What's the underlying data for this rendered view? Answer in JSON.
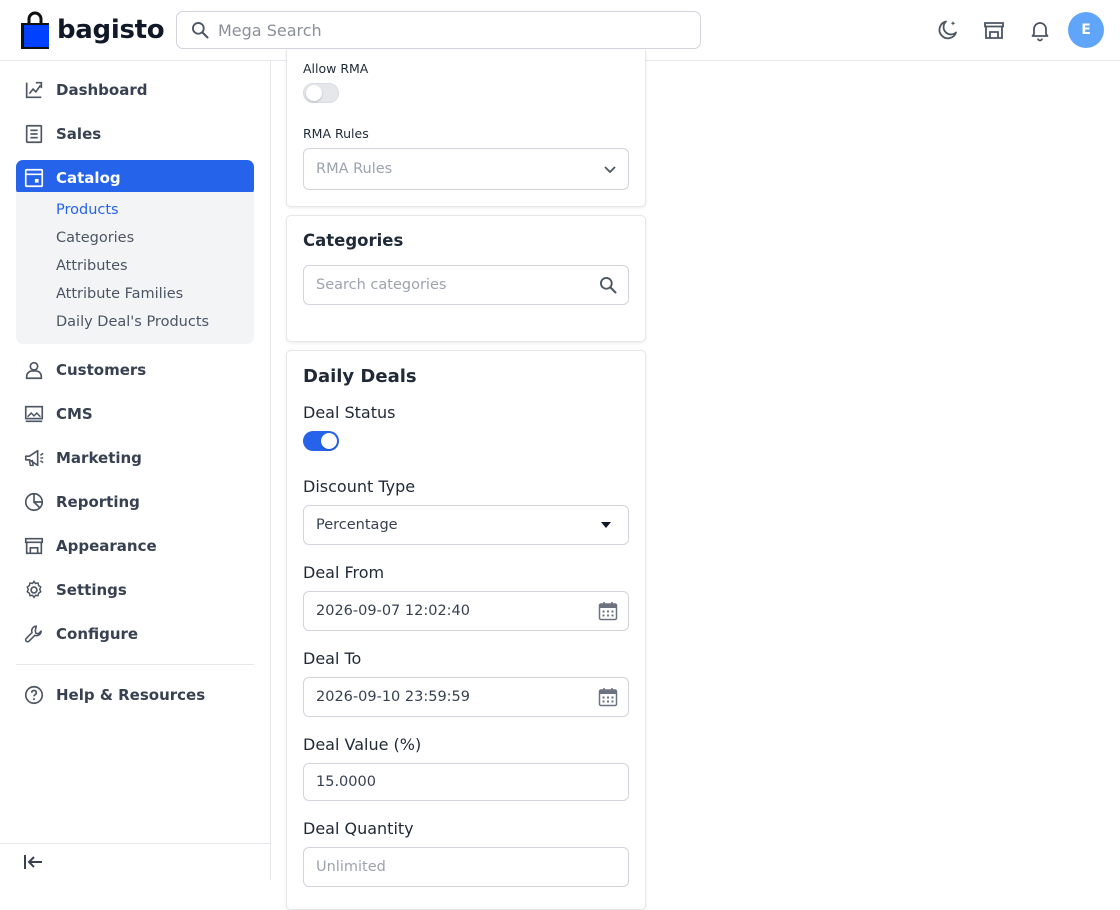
{
  "header": {
    "brand": "bagisto",
    "search_placeholder": "Mega Search",
    "avatar_initial": "E",
    "colors": {
      "accent": "#2563eb",
      "avatar": "#60a5fa",
      "logo_bag": "#0041ff"
    },
    "icons": [
      "moon-icon",
      "store-icon",
      "bell-icon"
    ]
  },
  "sidebar": {
    "items": [
      {
        "label": "Dashboard",
        "icon": "dashboard-icon"
      },
      {
        "label": "Sales",
        "icon": "sales-icon"
      },
      {
        "label": "Catalog",
        "icon": "catalog-icon"
      },
      {
        "label": "Customers",
        "icon": "customers-icon"
      },
      {
        "label": "CMS",
        "icon": "cms-icon"
      },
      {
        "label": "Marketing",
        "icon": "marketing-icon"
      },
      {
        "label": "Reporting",
        "icon": "reporting-icon"
      },
      {
        "label": "Appearance",
        "icon": "appearance-icon"
      },
      {
        "label": "Settings",
        "icon": "settings-icon"
      },
      {
        "label": "Configure",
        "icon": "configure-icon"
      },
      {
        "label": "Help & Resources",
        "icon": "help-icon"
      }
    ],
    "active_item": "Catalog",
    "catalog_sub": [
      "Products",
      "Categories",
      "Attributes",
      "Attribute Families",
      "Daily Deal's Products"
    ],
    "active_sub": "Products"
  },
  "rma_card": {
    "allow_rma_label": "Allow RMA",
    "allow_rma_enabled": false,
    "rma_rules_label": "RMA Rules",
    "rma_rules_placeholder": "RMA Rules"
  },
  "categories_card": {
    "title": "Categories",
    "search_placeholder": "Search categories"
  },
  "daily_deals_card": {
    "title": "Daily Deals",
    "deal_status_label": "Deal Status",
    "deal_status_enabled": true,
    "discount_type_label": "Discount Type",
    "discount_type_value": "Percentage",
    "deal_from_label": "Deal From",
    "deal_from_value": "2026-09-07 12:02:40",
    "deal_to_label": "Deal To",
    "deal_to_value": "2026-09-10 23:59:59",
    "deal_value_label": "Deal Value (%)",
    "deal_value_value": "15.0000",
    "deal_quantity_label": "Deal Quantity",
    "deal_quantity_placeholder": "Unlimited"
  }
}
